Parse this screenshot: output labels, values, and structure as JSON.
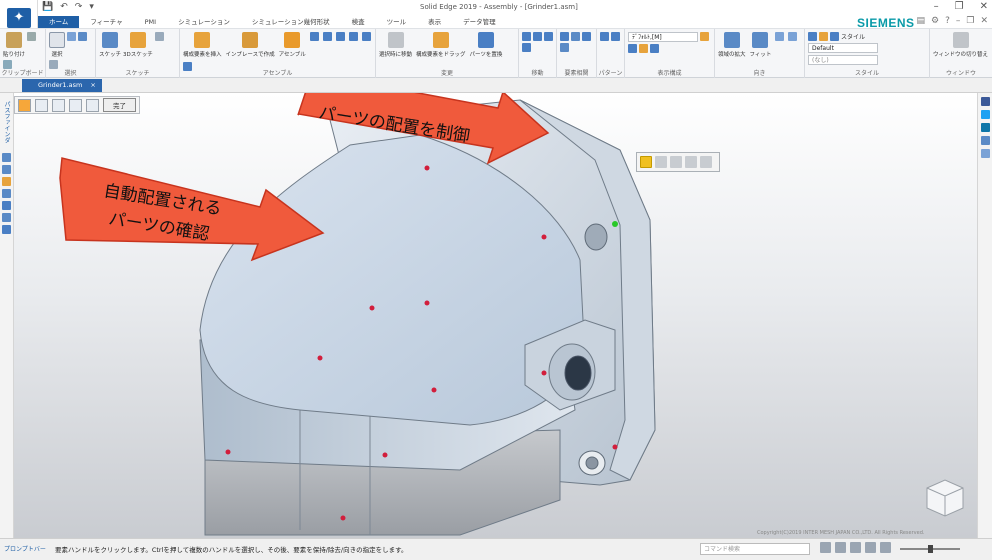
{
  "window": {
    "title": "Solid Edge 2019 - Assembly - [Grinder1.asm]",
    "brand": "SIEMENS",
    "controls": [
      "–",
      "❐",
      "✕"
    ]
  },
  "qat": [
    "💾",
    "↶",
    "↷",
    "▾"
  ],
  "tabs": [
    "ホーム",
    "フィーチャ",
    "PMI",
    "シミュレーション",
    "シミュレーション幾何形状",
    "検査",
    "ツール",
    "表示",
    "データ管理"
  ],
  "active_tab": 0,
  "ribbon": {
    "groups": [
      {
        "label": "クリップボード",
        "buttons": [
          "貼り付け"
        ]
      },
      {
        "label": "選択",
        "buttons": [
          "選択"
        ]
      },
      {
        "label": "スケッチ",
        "buttons": [
          "スケッチ",
          "3Dスケッチ"
        ]
      },
      {
        "label": "アセンブル",
        "buttons": [
          "構成要素を挿入",
          "インプレースで作成",
          "アセンブル"
        ]
      },
      {
        "label": "変更",
        "buttons": [
          "選択時に移動",
          "構成要素をドラッグ",
          "パーツを置換"
        ]
      },
      {
        "label": "移動",
        "buttons": []
      },
      {
        "label": "要素相関",
        "buttons": []
      },
      {
        "label": "パターン",
        "buttons": []
      },
      {
        "label": "表示構成",
        "buttons": [],
        "dropdown": "ﾃﾞﾌｫﾙﾄ,[M]"
      },
      {
        "label": "向き",
        "buttons": [
          "領域の拡大",
          "フィット"
        ]
      },
      {
        "label": "スタイル",
        "buttons": [],
        "style_label": "スタイル",
        "style_value": "Default",
        "style_value2": "(なし)"
      },
      {
        "label": "ウィンドウ",
        "buttons": [
          "ウィンドウの切り替え"
        ]
      }
    ]
  },
  "document_tab": {
    "name": "Grinder1.asm",
    "close": "×"
  },
  "command_bar": {
    "finish": "完了"
  },
  "left_dock_label": "パスファインダ",
  "callouts": [
    {
      "text_line1": "パーツの配置を制御"
    },
    {
      "text_line1": "自動配置される",
      "text_line2": "パーツの確認"
    }
  ],
  "copyright": "Copyright(C)2019 INTER MESH JAPAN CO.,LTD. All Rights Reserved.",
  "status": {
    "prompt_label": "プロンプトバー",
    "prompt_text": "要素ハンドルをクリックします。Ctrlを押して複数のハンドルを選択し、その後、要素を保持/除去/向きの指定をします。",
    "search_placeholder": "コマンド検索"
  },
  "colors": {
    "accent": "#1f5fa6",
    "callout_fill": "#f05a3c",
    "callout_stroke": "#c7341e",
    "highlight": "#f0c020",
    "dot": "#d21e3c",
    "edge_point": "#28c828"
  }
}
